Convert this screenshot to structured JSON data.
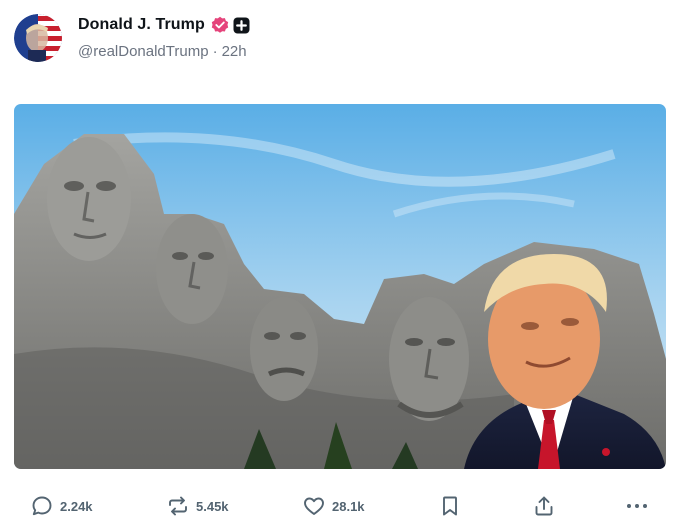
{
  "post": {
    "author": {
      "display_name": "Donald J. Trump",
      "handle": "@realDonaldTrump",
      "separator": "·",
      "time": "22h",
      "verified": true
    },
    "media": {
      "description_colors": {
        "sky": "#8fc6ea",
        "rock": "#8a8a86"
      }
    },
    "actions": {
      "reply_count": "2.24k",
      "repost_count": "5.45k",
      "like_count": "28.1k"
    }
  },
  "colors": {
    "verified_badge": "#e5447b",
    "icon": "#536471",
    "text_secondary": "#6b7380"
  }
}
